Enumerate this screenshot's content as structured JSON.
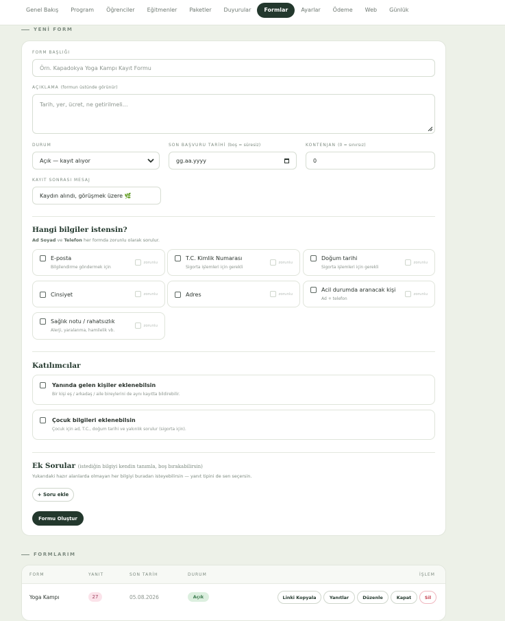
{
  "nav": [
    "Genel Bakış",
    "Program",
    "Öğrenciler",
    "Eğitmenler",
    "Paketler",
    "Duyurular",
    "Formlar",
    "Ayarlar",
    "Ödeme",
    "Web",
    "Günlük"
  ],
  "nav_active_index": 6,
  "new_form": {
    "section_label": "YENİ FORM",
    "title_label": "FORM BAŞLIĞI",
    "title_placeholder": "Örn. Kapadokya Yoga Kampı Kayıt Formu",
    "desc_label": "AÇIKLAMA",
    "desc_label_sub": "(formun üstünde görünür)",
    "desc_placeholder": "Tarih, yer, ücret, ne getirilmeli…",
    "status_label": "DURUM",
    "status_value": "Açık — kayıt alıyor",
    "deadline_label": "SON BAŞVURU TARİHİ",
    "deadline_label_sub": "(boş = süresiz)",
    "deadline_placeholder": "gg.aa.yyyy",
    "capacity_label": "KONTENJAN",
    "capacity_label_sub": "(0 = sınırsız)",
    "capacity_value": "0",
    "after_label": "KAYIT SONRASI MESAJ",
    "after_value": "Kaydın alındı, görüşmek üzere 🌿"
  },
  "fields_section": {
    "title": "Hangi bilgiler istensin?",
    "note_b1": "Ad Soyad",
    "note_mid": " ve ",
    "note_b2": "Telefon",
    "note_end": " her formda zorunlu olarak sorulur.",
    "required_label": "zorunlu",
    "options": [
      {
        "label": "E-posta",
        "desc": "Bilgilendirme göndermek için"
      },
      {
        "label": "T.C. Kimlik Numarası",
        "desc": "Sigorta işlemleri için gerekli"
      },
      {
        "label": "Doğum tarihi",
        "desc": "Sigorta işlemleri için gerekli"
      },
      {
        "label": "Cinsiyet",
        "desc": ""
      },
      {
        "label": "Adres",
        "desc": ""
      },
      {
        "label": "Acil durumda aranacak kişi",
        "desc": "Ad + telefon"
      },
      {
        "label": "Sağlık notu / rahatsızlık",
        "desc": "Alerji, yaralanma, hamilelik vb."
      }
    ]
  },
  "participants": {
    "title": "Katılımcılar",
    "options": [
      {
        "label": "Yanında gelen kişiler eklenebilsin",
        "desc": "Bir kişi eş / arkadaş / aile bireylerini de aynı kayıtta bildirebilir."
      },
      {
        "label": "Çocuk bilgileri eklenebilsin",
        "desc": "Çocuk için ad, T.C., doğum tarihi ve yakınlık sorulur (sigorta için)."
      }
    ]
  },
  "extra": {
    "title": "Ek Sorular",
    "title_sub": "(istediğin bilgiyi kendin tanımla, boş bırakabilirsin)",
    "note": "Yukarıdaki hazır alanlarda olmayan her bilgiyi buradan isteyebilirsin — yanıt tipini de sen seçersin.",
    "add_button": "+ Soru ekle",
    "create_button": "Formu Oluştur"
  },
  "forms_list": {
    "section_label": "FORMLARIM",
    "headers": {
      "form": "FORM",
      "count": "YANIT",
      "deadline": "SON TARİH",
      "status": "DURUM",
      "actions": "İŞLEM"
    },
    "rows": [
      {
        "form": "Yoga Kampı",
        "count": "27",
        "deadline": "05.08.2026",
        "status": "Açık"
      }
    ],
    "actions": [
      "Linki Kopyala",
      "Yanıtlar",
      "Düzenle",
      "Kapat",
      "Sil"
    ]
  },
  "colors": {
    "accent": "#23382d",
    "background": "#edf1e8",
    "danger": "#c23a4a",
    "pink_badge": "#fbe3ea",
    "green_badge": "#dcefdf"
  }
}
